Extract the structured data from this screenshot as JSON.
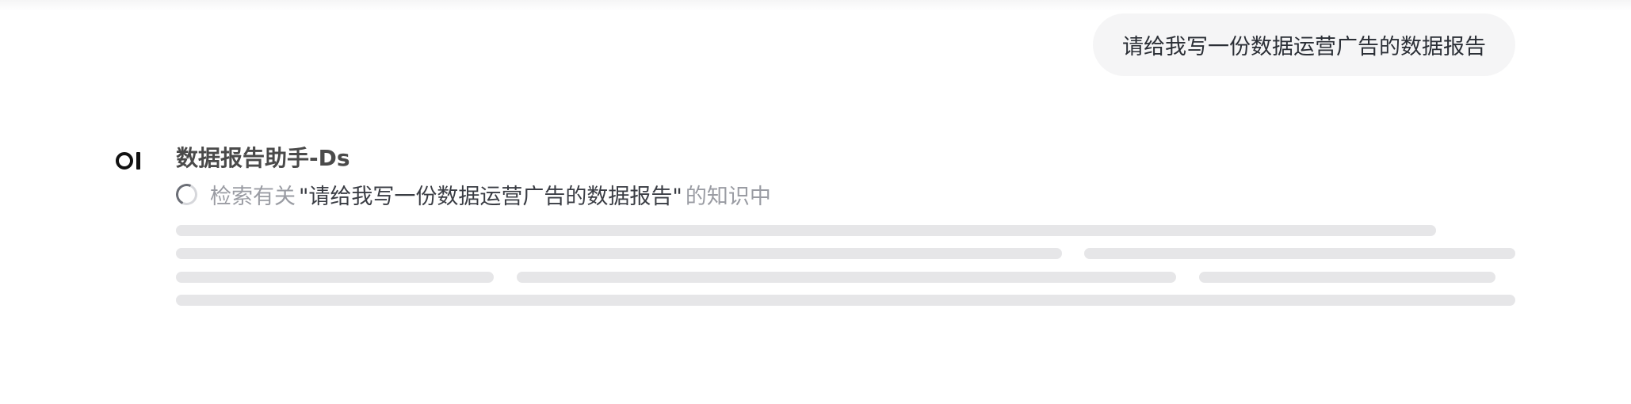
{
  "user_message": {
    "text": "请给我写一份数据运营广告的数据报告"
  },
  "assistant": {
    "logo_icon": "openai-style-logo-icon",
    "name": "数据报告助手-Ds",
    "status": {
      "spinner_icon": "loading-spinner-icon",
      "prefix": "检索有关",
      "query": "\"请给我写一份数据运营广告的数据报告\"",
      "suffix": "的知识中"
    },
    "skeleton_state": "loading"
  },
  "colors": {
    "bubble_bg": "#f5f5f6",
    "skeleton": "#e6e6e8",
    "muted_text": "#9a9ca3"
  }
}
